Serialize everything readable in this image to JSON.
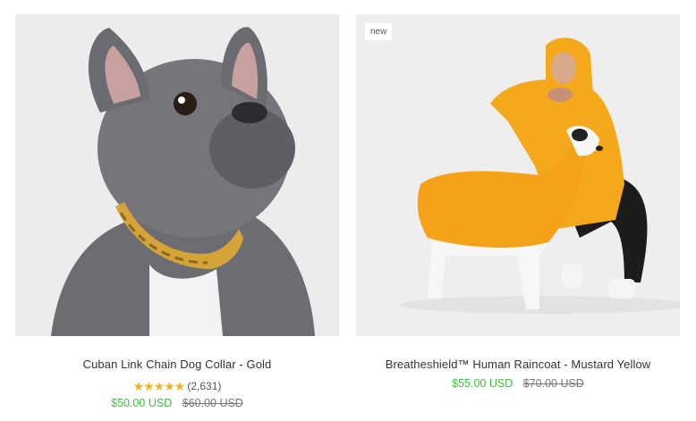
{
  "products": [
    {
      "title": "Cuban Link Chain Dog Collar - Gold",
      "rating_stars": "★★★★★",
      "rating_count": "(2,631)",
      "price": "$50.00 USD",
      "compare_price": "$60.00 USD",
      "badge": ""
    },
    {
      "title": "Breatheshield™ Human Raincoat - Mustard Yellow",
      "price": "$55.00 USD",
      "compare_price": "$70.00 USD",
      "badge": "new"
    }
  ],
  "colors": {
    "sale_price": "#3fbf3f",
    "star": "#f2b21c"
  }
}
